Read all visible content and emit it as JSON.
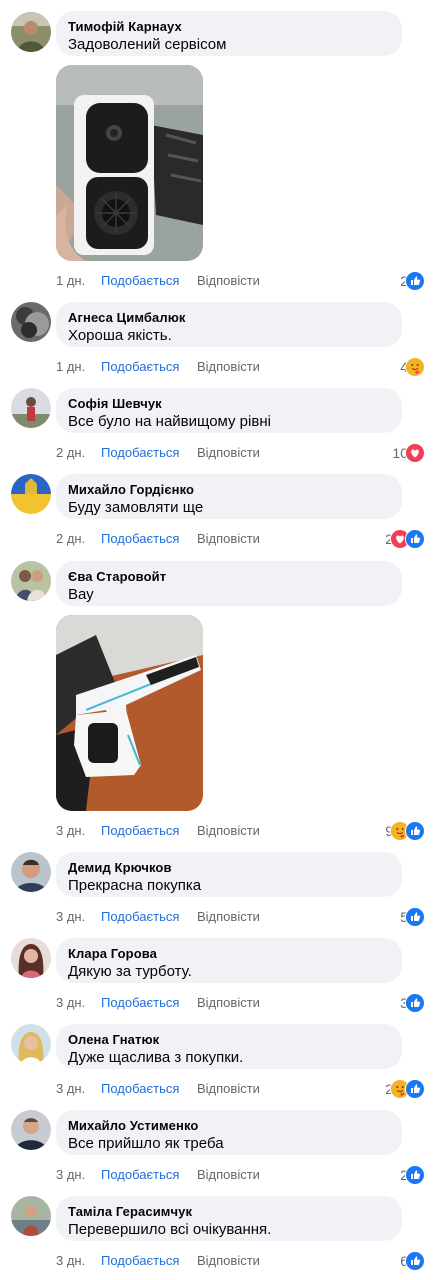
{
  "labels": {
    "like": "Подобається",
    "reply": "Відповісти"
  },
  "colors": {
    "link": "#216fdb",
    "bubble": "#f0f2f5",
    "muted": "#65676b",
    "like_icon": "#1877f2",
    "love_icon": "#f33e58",
    "care_icon": "#f7b125"
  },
  "comments": [
    {
      "author": "Тимофій Карнаух",
      "text": "Задоволений сервісом",
      "time": "1 дн.",
      "count": "2",
      "reactions": [
        "like-icon"
      ],
      "has_photo": true
    },
    {
      "author": "Агнеса Цимбалюк",
      "text": "Хороша якість.",
      "time": "1 дн.",
      "count": "4",
      "reactions": [
        "care-icon"
      ]
    },
    {
      "author": "Софія Шевчук",
      "text": "Все було на найвищому рівні",
      "time": "2 дн.",
      "count": "10",
      "reactions": [
        "love-icon"
      ]
    },
    {
      "author": "Михайло Гордієнко",
      "text": "Буду замовляти ще",
      "time": "2 дн.",
      "count": "2",
      "reactions": [
        "love-icon",
        "like-icon"
      ]
    },
    {
      "author": "Єва Старовойт",
      "text": "Вау",
      "time": "3 дн.",
      "count": "9",
      "reactions": [
        "care-icon",
        "like-icon"
      ],
      "has_photo": true
    },
    {
      "author": "Демид Крючков",
      "text": "Прекрасна покупка",
      "time": "3 дн.",
      "count": "5",
      "reactions": [
        "like-icon"
      ]
    },
    {
      "author": "Клара Горова",
      "text": "Дякую за турботу.",
      "time": "3 дн.",
      "count": "3",
      "reactions": [
        "like-icon"
      ]
    },
    {
      "author": "Олена Гнатюк",
      "text": "Дуже щаслива з покупки.",
      "time": "3 дн.",
      "count": "2",
      "reactions": [
        "care-icon",
        "like-icon"
      ]
    },
    {
      "author": "Михайло Устименко",
      "text": "Все прийшло як треба",
      "time": "3 дн.",
      "count": "2",
      "reactions": [
        "like-icon"
      ]
    },
    {
      "author": "Таміла Герасимчук",
      "text": "Перевершило всі очікування.",
      "time": "3 дн.",
      "count": "6",
      "reactions": [
        "like-icon"
      ]
    }
  ]
}
